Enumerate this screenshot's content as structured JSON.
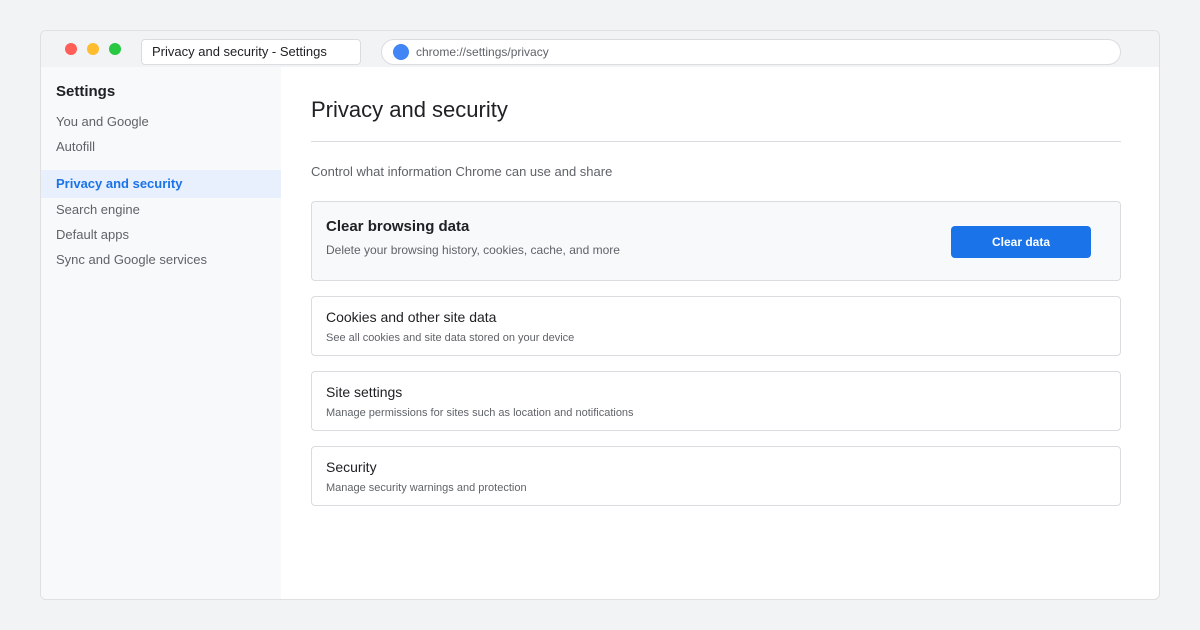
{
  "window": {
    "tab_title": "Privacy and security - Settings",
    "url": "chrome://settings/privacy"
  },
  "sidebar": {
    "title": "Settings",
    "items": [
      {
        "label": "You and Google"
      },
      {
        "label": "Autofill"
      },
      {
        "label": "Privacy and security",
        "active": true
      },
      {
        "label": "Search engine"
      },
      {
        "label": "Default apps"
      },
      {
        "label": "Sync and Google services"
      }
    ]
  },
  "main": {
    "title": "Privacy and security",
    "subtitle": "Control what information Chrome can use and share",
    "cards": [
      {
        "title": "Clear browsing data",
        "description": "Delete your browsing history, cookies, cache, and more",
        "button": "Clear data"
      },
      {
        "title": "Cookies and other site data",
        "description": "See all cookies and site data stored on your device"
      },
      {
        "title": "Site settings",
        "description": "Manage permissions for sites such as location and notifications"
      },
      {
        "title": "Security",
        "description": "Manage security warnings and protection"
      }
    ]
  },
  "colors": {
    "accent": "#1a73e8",
    "active_bg": "#e8f0fe",
    "traffic_red": "#ff5f57",
    "traffic_yellow": "#febc2e",
    "traffic_green": "#28c840"
  }
}
